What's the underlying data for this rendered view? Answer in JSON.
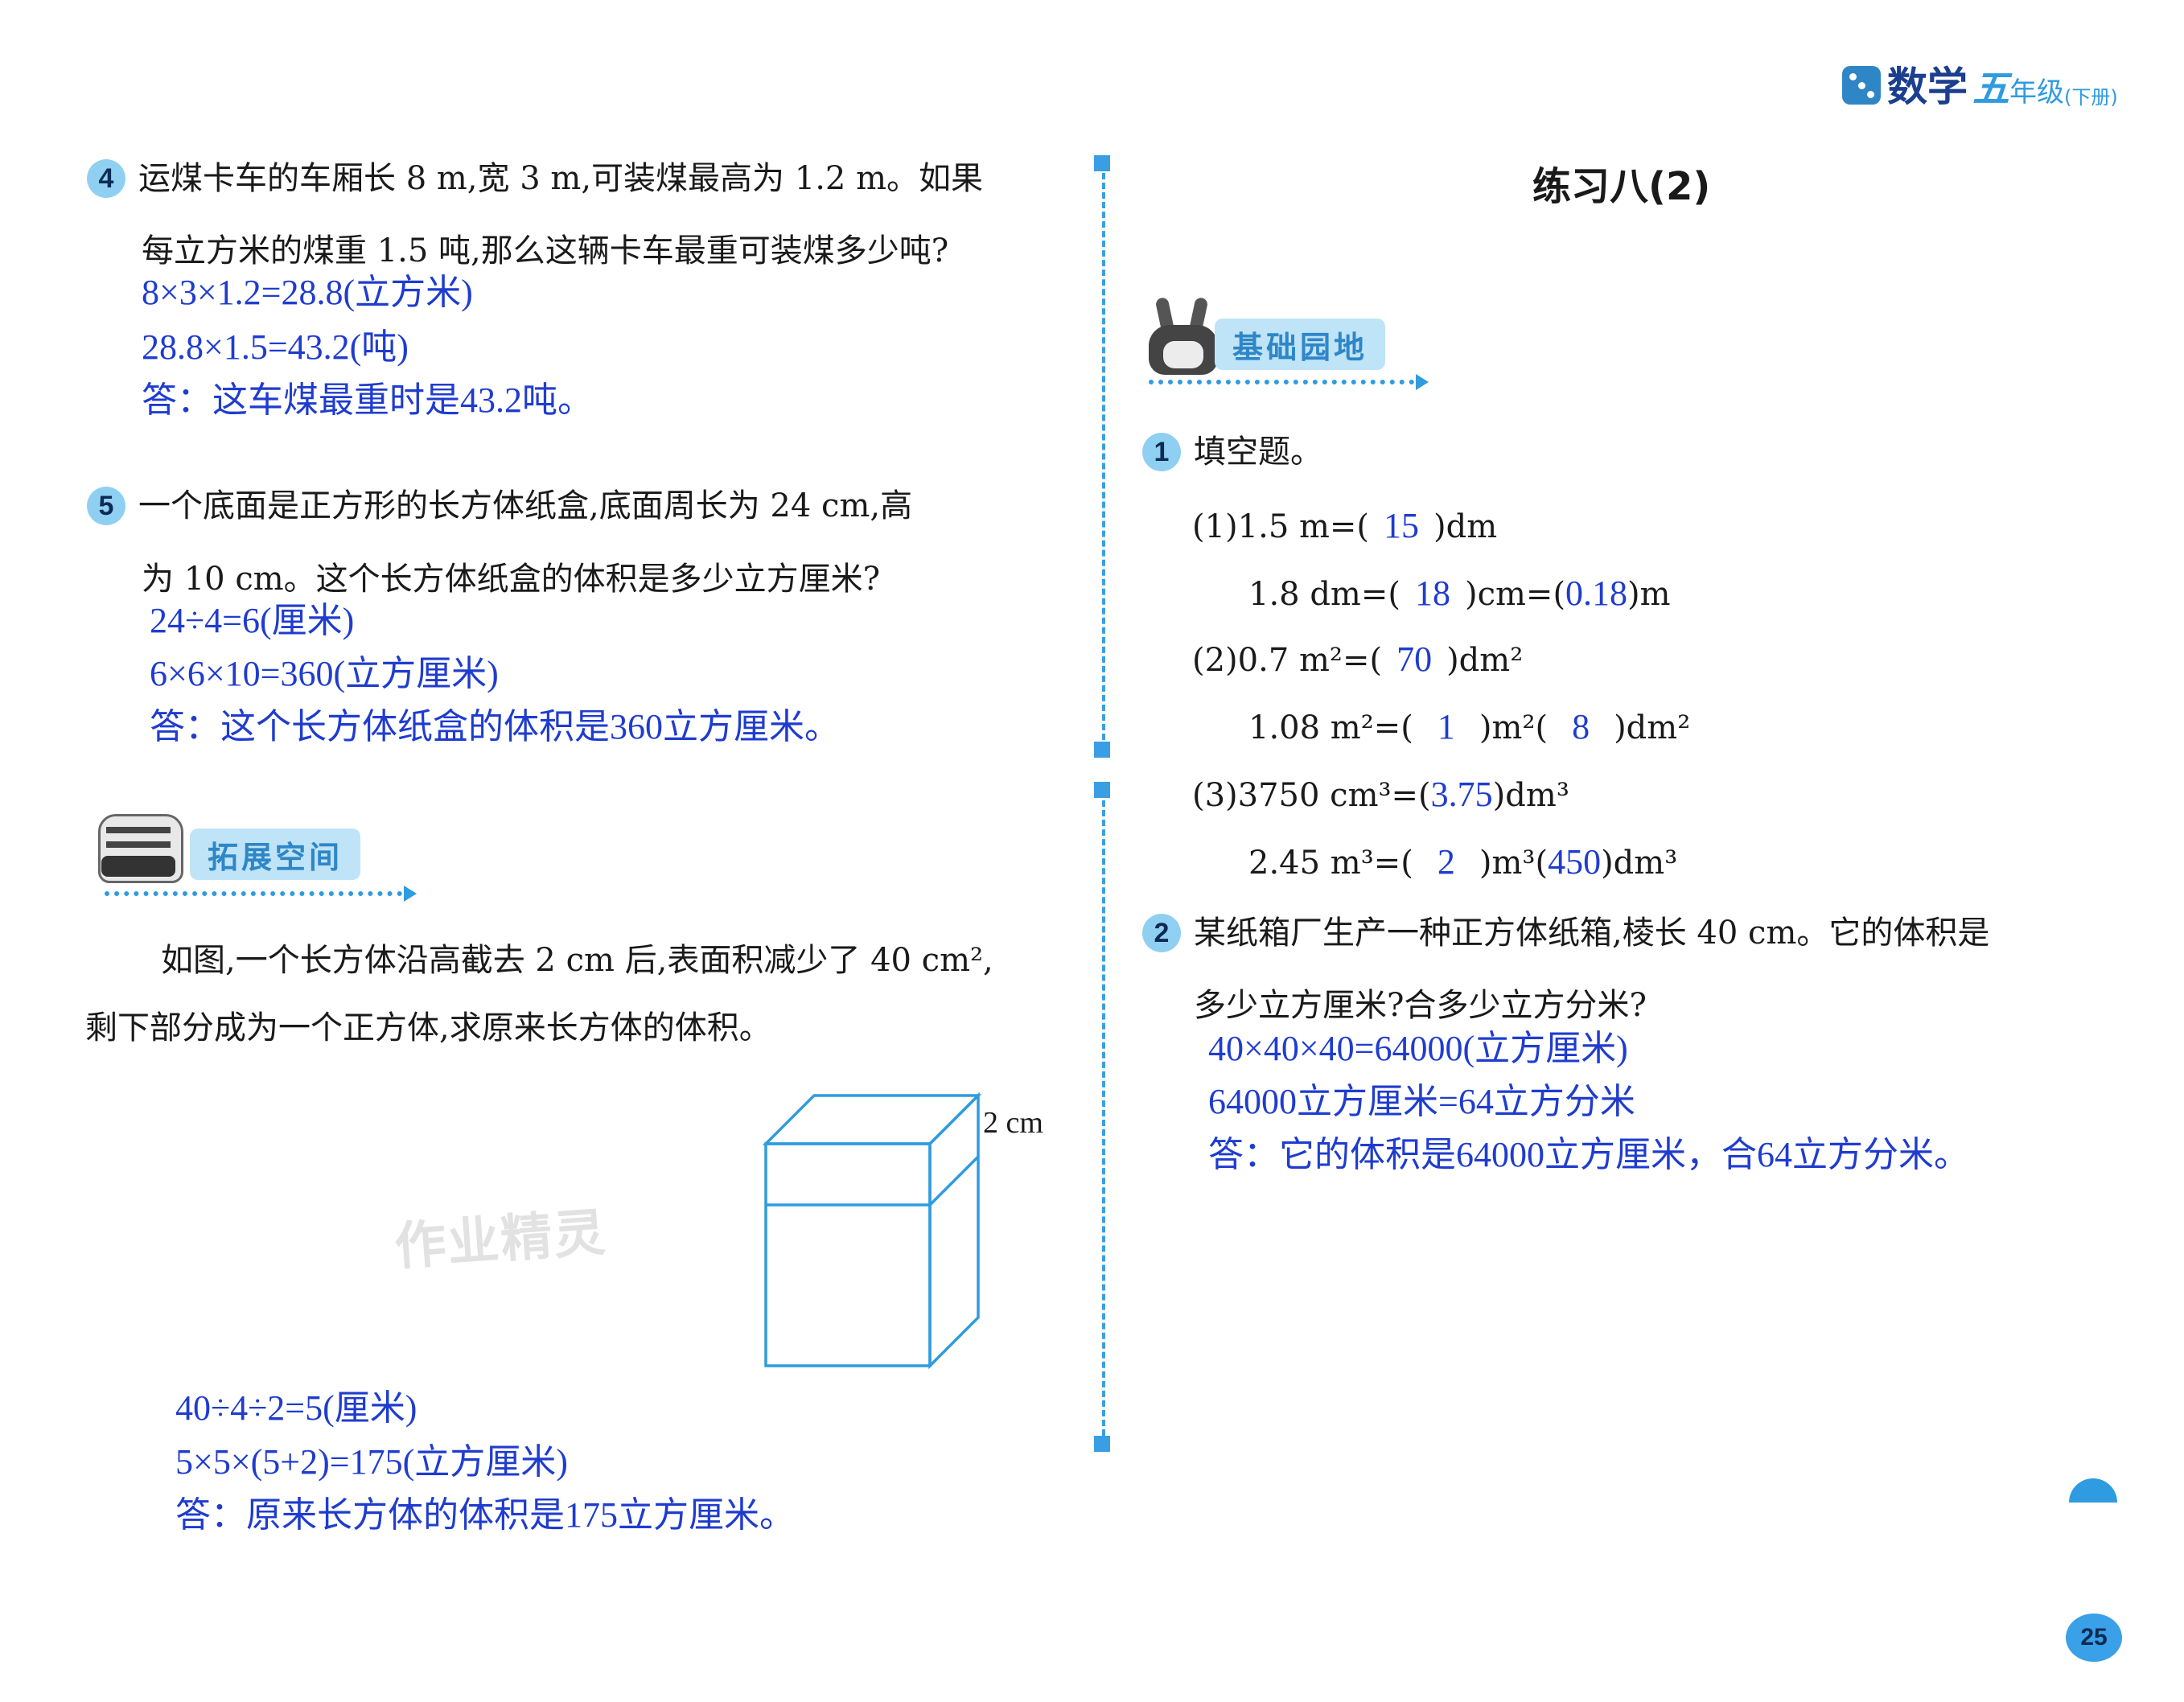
{
  "header": {
    "brand_icon": "dice-icon",
    "subject": "数学",
    "grade_char": "五",
    "grade_label": "年级",
    "volume": "(下册)"
  },
  "left": {
    "q4": {
      "number": "4",
      "line1": "运煤卡车的车厢长 8 m,宽 3 m,可装煤最高为 1.2 m。如果",
      "line2": "每立方米的煤重 1.5 吨,那么这辆卡车最重可装煤多少吨?",
      "answers": [
        "8×3×1.2=28.8(立方米)",
        "28.8×1.5=43.2(吨)",
        "答：这车煤最重时是43.2吨。"
      ]
    },
    "q5": {
      "number": "5",
      "line1": "一个底面是正方形的长方体纸盒,底面周长为 24 cm,高",
      "line2": "为 10 cm。这个长方体纸盒的体积是多少立方厘米?",
      "answers": [
        "24÷4=6(厘米)",
        "6×6×10=360(立方厘米)",
        "答：这个长方体纸盒的体积是360立方厘米。"
      ]
    },
    "extension": {
      "title": "拓展空间",
      "line1": "如图,一个长方体沿高截去 2 cm 后,表面积减少了 40 cm²,",
      "line2": "剩下部分成为一个正方体,求原来长方体的体积。",
      "figure_label": "2 cm",
      "watermark": "作业精灵",
      "answers": [
        "40÷4÷2=5(厘米)",
        "5×5×(5+2)=175(立方厘米)",
        "答：原来长方体的体积是175立方厘米。"
      ]
    }
  },
  "right": {
    "title": "练习八(2)",
    "basics_title": "基础园地",
    "q1": {
      "number": "1",
      "text": "填空题。",
      "l1_pre": "(1)1.5 m=(",
      "l1_a": "15",
      "l1_post": ")dm",
      "l2_pre": "1.8 dm=(",
      "l2_a": "18",
      "l2_mid": ")cm=(",
      "l2_b": "0.18",
      "l2_post": ")m",
      "l3_pre": "(2)0.7 m²=(",
      "l3_a": "70",
      "l3_post": ")dm²",
      "l4_pre": "1.08 m²=(",
      "l4_a": "1",
      "l4_mid": ")m²(",
      "l4_b": "8",
      "l4_post": ")dm²",
      "l5_pre": "(3)3750 cm³=(",
      "l5_a": "3.75",
      "l5_post": ")dm³",
      "l6_pre": "2.45 m³=(",
      "l6_a": "2",
      "l6_mid": ")m³(",
      "l6_b": "450",
      "l6_post": ")dm³"
    },
    "q2": {
      "number": "2",
      "line1": "某纸箱厂生产一种正方体纸箱,棱长 40 cm。它的体积是",
      "line2": "多少立方厘米?合多少立方分米?",
      "answers": [
        "40×40×40=64000(立方厘米)",
        "64000立方厘米=64立方分米",
        "答：它的体积是64000立方厘米，合64立方分米。"
      ]
    }
  },
  "page_number": "25",
  "colors": {
    "accent": "#2f9be0",
    "answer": "#1f3ccf",
    "tab_bg": "#bfe4f7"
  }
}
